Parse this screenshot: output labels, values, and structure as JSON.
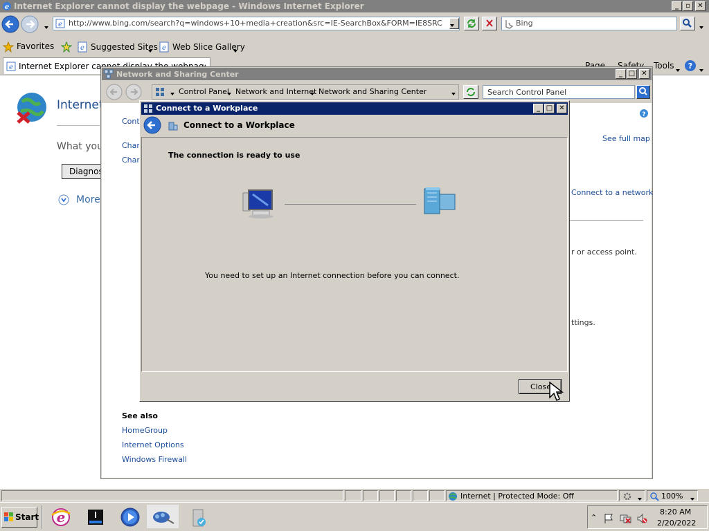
{
  "ie": {
    "title": "Internet Explorer cannot display the webpage - Windows Internet Explorer",
    "address": "http://www.bing.com/search?q=windows+10+media+creation&src=IE-SearchBox&FORM=IE8SRC",
    "search_placeholder": "Bing",
    "favorites_label": "Favorites",
    "suggested_sites_label": "Suggested Sites",
    "web_slice_label": "Web Slice Gallery",
    "tab_label": "Internet Explorer cannot display the webpage",
    "cmd_page": "Page",
    "cmd_safety": "Safety",
    "cmd_tools": "Tools",
    "page_heading": "Internet",
    "page_question": "What you",
    "diagnose_label": "Diagnos",
    "more_label": "More",
    "status_zone": "Internet | Protected Mode: Off",
    "zoom": "100%"
  },
  "nsc": {
    "title": "Network and Sharing Center",
    "breadcrumb": [
      "Control Panel",
      "Network and Internet",
      "Network and Sharing Center"
    ],
    "search_placeholder": "Search Control Panel",
    "left_link_1": "Contr",
    "left_link_2": "Chan",
    "left_link_3": "Chan",
    "see_full_map": "See full map",
    "connect_network": "Connect to a network",
    "frag_access_point": "r or access point.",
    "frag_settings": "ttings.",
    "see_also_heading": "See also",
    "see_also": [
      "HomeGroup",
      "Internet Options",
      "Windows Firewall"
    ]
  },
  "dialog": {
    "title": "Connect to a Workplace",
    "header": "Connect to a Workplace",
    "status_heading": "The connection is ready to use",
    "message": "You need to set up an Internet connection before you can connect.",
    "close_label": "Close"
  },
  "taskbar": {
    "start_label": "Start",
    "time": "8:20 AM",
    "date": "2/20/2022"
  },
  "colors": {
    "title_active": "#0a246a",
    "title_inactive": "#808080",
    "link": "#0645ad",
    "button_face": "#d4d0c8"
  }
}
